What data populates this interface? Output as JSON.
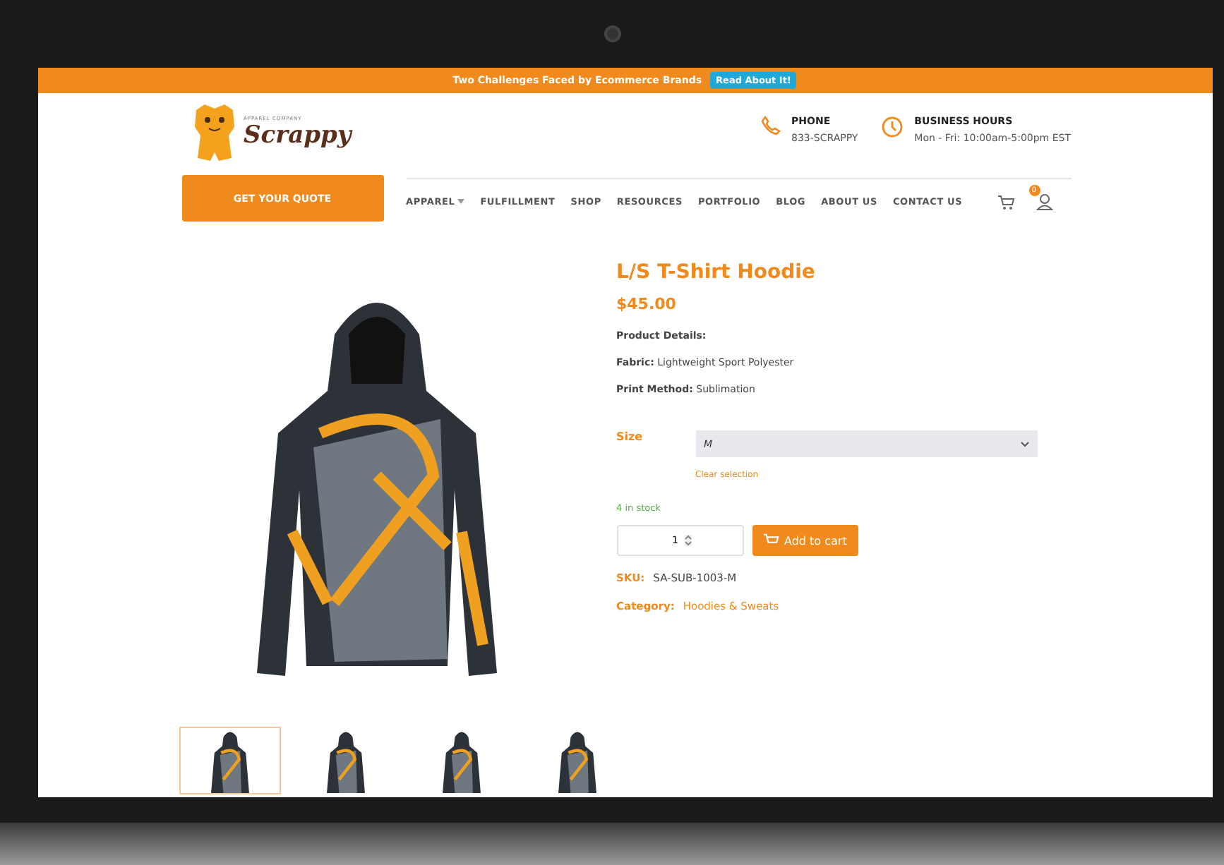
{
  "announcement": {
    "text": "Two Challenges Faced by Ecommerce Brands",
    "button": "Read About It!"
  },
  "logo": {
    "tagline": "APPAREL COMPANY",
    "name": "Scrappy"
  },
  "contacts": [
    {
      "kind": "phone",
      "label": "PHONE",
      "value": "833-SCRAPPY"
    },
    {
      "kind": "hours",
      "label": "BUSINESS HOURS",
      "value": "Mon - Fri: 10:00am-5:00pm EST"
    }
  ],
  "quote_button": "GET YOUR QUOTE",
  "nav": [
    {
      "label": "APPAREL",
      "dropdown": true
    },
    {
      "label": "FULFILLMENT",
      "dropdown": false
    },
    {
      "label": "SHOP",
      "dropdown": false
    },
    {
      "label": "RESOURCES",
      "dropdown": false
    },
    {
      "label": "PORTFOLIO",
      "dropdown": false
    },
    {
      "label": "BLOG",
      "dropdown": false
    },
    {
      "label": "ABOUT US",
      "dropdown": false
    },
    {
      "label": "CONTACT US",
      "dropdown": false
    }
  ],
  "cart_count": "0",
  "product": {
    "title": "L/S T-Shirt Hoodie",
    "price": "$45.00",
    "details": [
      "**Product Details:**",
      "**Fabric:** Lightweight Sport Polyester",
      "**Print Method:** Sublimation"
    ],
    "size_label": "Size",
    "size_value": "M",
    "clear": "Clear selection",
    "stock": "4 in stock",
    "quantity": "1",
    "add_to_cart": "Add to cart",
    "sku_label": "SKU:",
    "sku": "SA-SUB-1003-M",
    "category_label": "Category:",
    "category": "Hoodies & Sweats"
  },
  "thumbnails": [
    {
      "selected": true
    },
    {
      "selected": false
    },
    {
      "selected": false
    },
    {
      "selected": false
    }
  ]
}
